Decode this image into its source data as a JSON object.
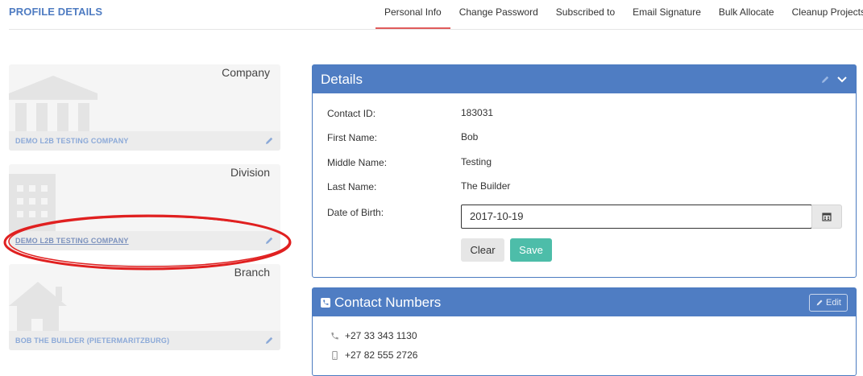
{
  "header": {
    "title": "PROFILE DETAILS",
    "tabs": [
      {
        "label": "Personal Info",
        "active": true
      },
      {
        "label": "Change Password"
      },
      {
        "label": "Subscribed to"
      },
      {
        "label": "Email Signature"
      },
      {
        "label": "Bulk Allocate"
      },
      {
        "label": "Cleanup Projects"
      }
    ]
  },
  "sidebar": {
    "cards": [
      {
        "label": "Company",
        "name": "DEMO L2B TESTING COMPANY",
        "icon": "building-columns-icon"
      },
      {
        "label": "Division",
        "name": "DEMO L2B TESTING COMPANY",
        "icon": "office-building-icon"
      },
      {
        "label": "Branch",
        "name": "BOB THE BUILDER (PIETERMARITZBURG)",
        "icon": "house-icon"
      }
    ]
  },
  "details": {
    "title": "Details",
    "fields": [
      {
        "label": "Contact ID:",
        "value": "183031"
      },
      {
        "label": "First Name:",
        "value": "Bob"
      },
      {
        "label": "Middle Name:",
        "value": "Testing"
      },
      {
        "label": "Last Name:",
        "value": "The Builder"
      }
    ],
    "dob_label": "Date of Birth:",
    "dob_value": "2017-10-19",
    "clear_label": "Clear",
    "save_label": "Save"
  },
  "contact_numbers": {
    "title": "Contact Numbers",
    "edit_label": "Edit",
    "numbers": [
      {
        "type": "phone-icon",
        "value": "+27 33 343 1130"
      },
      {
        "type": "mobile-icon",
        "value": "+27 82 555 2726"
      }
    ]
  },
  "colors": {
    "brand": "#4f7dc3",
    "tab_active": "#e05b5b",
    "save": "#4dbda9",
    "annotation": "#e02020"
  }
}
